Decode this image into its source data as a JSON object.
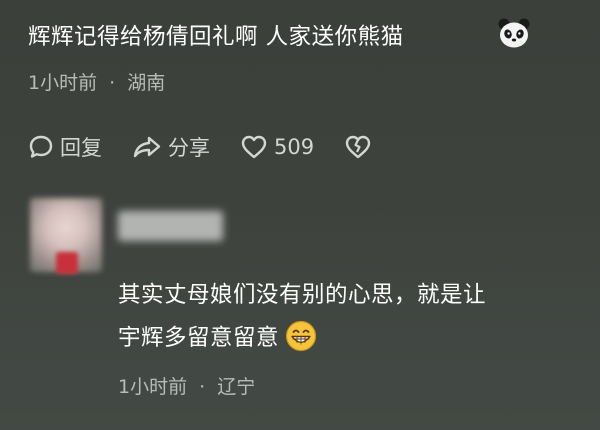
{
  "comment1": {
    "text": "辉辉记得给杨倩回礼啊  人家送你熊猫",
    "emoji": "panda-emoji",
    "time": "1小时前",
    "location": "湖南",
    "separator": "·",
    "actions": {
      "reply_label": "回复",
      "share_label": "分享",
      "like_count": "509"
    }
  },
  "comment2": {
    "text_line1": "其实丈母娘们没有别的心思，就是让",
    "text_line2": "宇辉多留意留意",
    "emoji": "grinning-emoji",
    "time": "1小时前",
    "location": "辽宁",
    "separator": "·"
  },
  "colors": {
    "background": "#3e423d",
    "text": "#ffffff",
    "meta": "#b8bcb8"
  }
}
